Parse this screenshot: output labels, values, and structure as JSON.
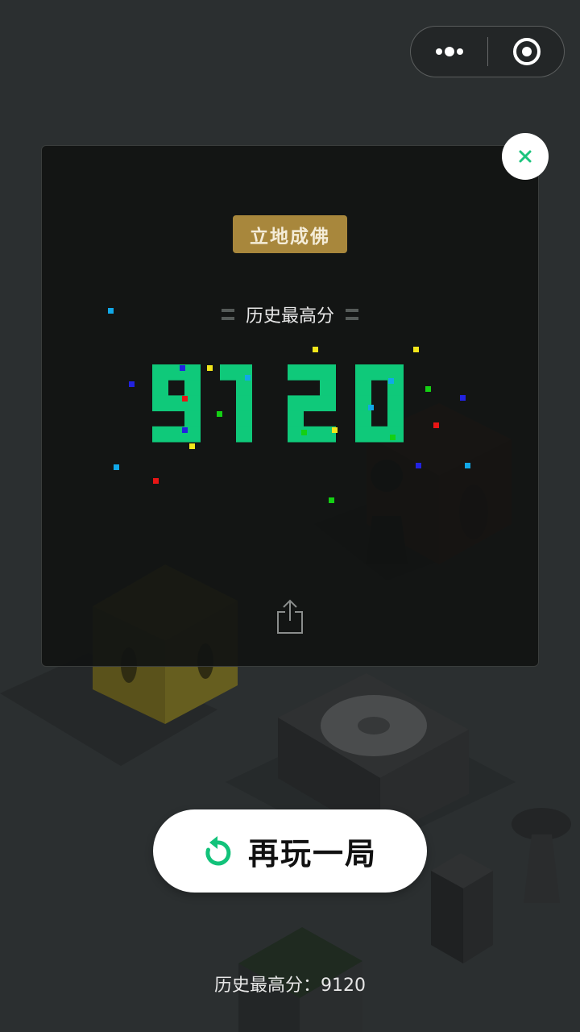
{
  "menu": {
    "more_icon": "more-dots-icon",
    "close_icon": "target-circle-icon"
  },
  "result": {
    "title_badge": "立地成佛",
    "best_label": "历史最高分",
    "score": "9120",
    "score_color": "#0fc97a",
    "badge_color": "#a8873c",
    "share_icon": "share-icon",
    "close_icon": "close-icon"
  },
  "actions": {
    "play_again": "再玩一局",
    "play_again_icon": "restart-icon"
  },
  "footer": {
    "best_text": "历史最高分：9120"
  }
}
